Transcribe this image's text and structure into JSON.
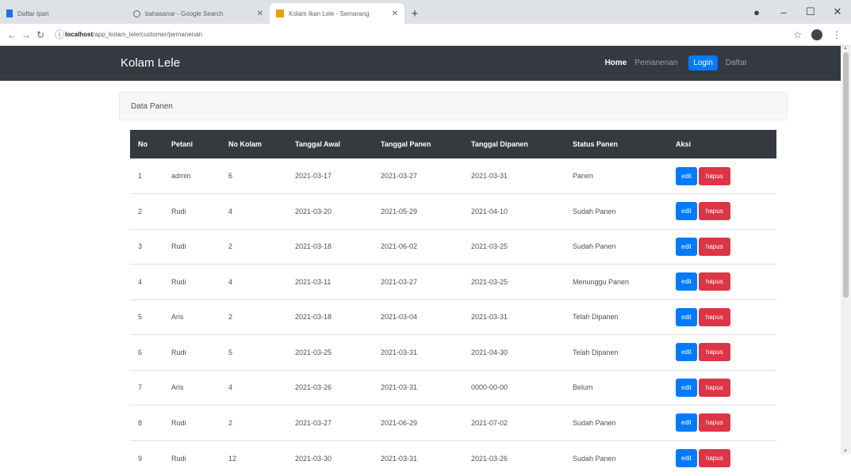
{
  "browser": {
    "tabs": [
      {
        "title": "Daftar Ipan"
      },
      {
        "title": "bahasanar - Google Search"
      },
      {
        "title": "Kolam Ikan Lele - Semarang"
      }
    ],
    "url_host": "localhost",
    "url_path": "/app_kolam_lele/customer/pemanenan"
  },
  "navbar": {
    "brand": "Kolam Lele",
    "links": {
      "home": "Home",
      "pemanenan": "Pemanenan",
      "login": "Login",
      "daftar": "Daftar"
    }
  },
  "card": {
    "title": "Data Panen"
  },
  "table": {
    "headers": [
      "No",
      "Petani",
      "No Kolam",
      "Tanggal Awal",
      "Tanggal Panen",
      "Tanggal Dipanen",
      "Status Panen",
      "Aksi"
    ],
    "edit_label": "edit",
    "hapus_label": "hapus",
    "rows": [
      {
        "no": "1",
        "petani": "admin",
        "kolam": "6",
        "awal": "2021-03-17",
        "panen": "2021-03-27",
        "dipanen": "2021-03-31",
        "status": "Panen"
      },
      {
        "no": "2",
        "petani": "Rudi",
        "kolam": "4",
        "awal": "2021-03-20",
        "panen": "2021-05-29",
        "dipanen": "2021-04-10",
        "status": "Sudah Panen"
      },
      {
        "no": "3",
        "petani": "Rudi",
        "kolam": "2",
        "awal": "2021-03-18",
        "panen": "2021-06-02",
        "dipanen": "2021-03-25",
        "status": "Sudah Panen"
      },
      {
        "no": "4",
        "petani": "Rudi",
        "kolam": "4",
        "awal": "2021-03-11",
        "panen": "2021-03-27",
        "dipanen": "2021-03-25",
        "status": "Menunggu Panen"
      },
      {
        "no": "5",
        "petani": "Aris",
        "kolam": "2",
        "awal": "2021-03-18",
        "panen": "2021-03-04",
        "dipanen": "2021-03-31",
        "status": "Telah Dipanen"
      },
      {
        "no": "6",
        "petani": "Rudi",
        "kolam": "5",
        "awal": "2021-03-25",
        "panen": "2021-03-31",
        "dipanen": "2021-04-30",
        "status": "Telah Dipanen"
      },
      {
        "no": "7",
        "petani": "Aris",
        "kolam": "4",
        "awal": "2021-03-26",
        "panen": "2021-03-31",
        "dipanen": "0000-00-00",
        "status": "Belum"
      },
      {
        "no": "8",
        "petani": "Rudi",
        "kolam": "2",
        "awal": "2021-03-27",
        "panen": "2021-06-29",
        "dipanen": "2021-07-02",
        "status": "Sudah Panen"
      },
      {
        "no": "9",
        "petani": "Rudi",
        "kolam": "12",
        "awal": "2021-03-30",
        "panen": "2021-03-31",
        "dipanen": "2021-03-26",
        "status": "Sudah Panen"
      }
    ]
  },
  "colors": {
    "navbar": "#343a40",
    "primary": "#007bff",
    "danger": "#dc3545"
  }
}
